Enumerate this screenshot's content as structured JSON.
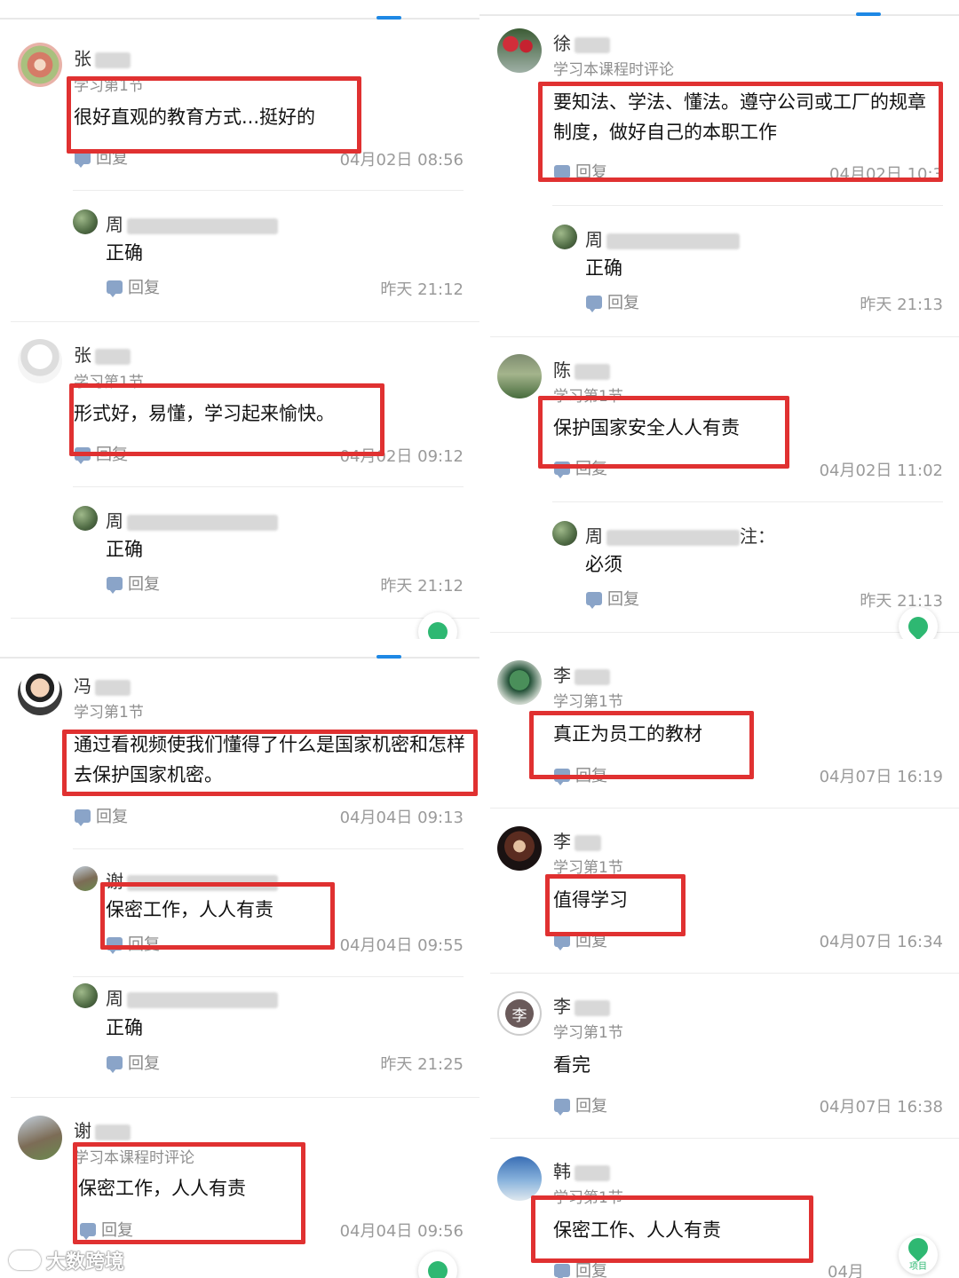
{
  "colors": {
    "accent": "#1e88e5",
    "highlight": "#e03131",
    "fab": "#2eb872"
  },
  "panel1": {
    "c1": {
      "name": "张",
      "sub": "学习第1节",
      "text": "很好直观的教育方式...挺好的",
      "reply": "回复",
      "time": "04月02日 08:56"
    },
    "r1": {
      "name": "周",
      "text": "正确",
      "reply": "回复",
      "time": "昨天 21:12"
    },
    "c2": {
      "name": "张",
      "sub": "学习第1节",
      "text": "形式好，易懂，学习起来愉快。",
      "reply": "回复",
      "time": "04月02日 09:12"
    },
    "r2": {
      "name": "周",
      "text": "正确",
      "reply": "回复",
      "time": "昨天 21:12"
    }
  },
  "panel2": {
    "c1": {
      "name": "徐",
      "sub": "学习本课程时评论",
      "text": "要知法、学法、懂法。遵守公司或工厂的规章制度，做好自己的本职工作",
      "reply": "回复",
      "time": "04月02日 10:3"
    },
    "r1": {
      "name": "周",
      "text": "正确",
      "reply": "回复",
      "time": "昨天 21:13"
    },
    "c2": {
      "name": "陈",
      "sub": "学习第1节",
      "text": "保护国家安全人人有责",
      "reply": "回复",
      "time": "04月02日 11:02"
    },
    "r2": {
      "name": "周",
      "name_suffix": "注：",
      "text": "必须",
      "reply": "回复",
      "time": "昨天 21:13"
    }
  },
  "panel3": {
    "c1": {
      "name": "冯",
      "sub": "学习第1节",
      "text": "通过看视频使我们懂得了什么是国家机密和怎样去保护国家机密。",
      "reply": "回复",
      "time": "04月04日 09:13"
    },
    "r1": {
      "name": "谢",
      "text": "保密工作，人人有责",
      "reply": "回复",
      "time": "04月04日 09:55"
    },
    "r2": {
      "name": "周",
      "text": "正确",
      "reply": "回复",
      "time": "昨天 21:25"
    },
    "c2": {
      "name": "谢",
      "sub": "学习本课程时评论",
      "text": "保密工作，人人有责",
      "reply": "回复",
      "time": "04月04日 09:56"
    }
  },
  "panel4": {
    "c1": {
      "name": "李",
      "sub": "学习第1节",
      "text": "真正为员工的教材",
      "reply": "回复",
      "time": "04月07日 16:19"
    },
    "c2": {
      "name": "李",
      "sub": "学习第1节",
      "text": "值得学习",
      "reply": "回复",
      "time": "04月07日 16:34"
    },
    "c3": {
      "name": "李",
      "avatar_char": "李",
      "sub": "学习第1节",
      "text": "看完",
      "reply": "回复",
      "time": "04月07日 16:38"
    },
    "c4": {
      "name": "韩",
      "sub": "学习第1节",
      "text": "保密工作、人人有责",
      "reply": "回复",
      "time": "04月07日"
    }
  },
  "fab": {
    "label": "项目"
  },
  "watermark": {
    "text": "大数跨境"
  }
}
